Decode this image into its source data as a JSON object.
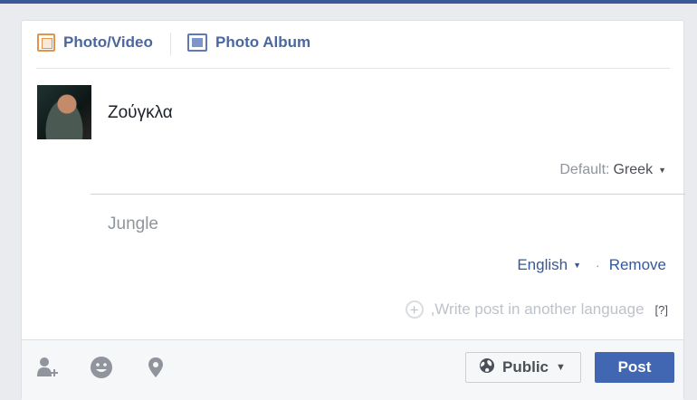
{
  "tabs": {
    "photo_video": "Photo/Video",
    "photo_album": "Photo Album"
  },
  "composer": {
    "post_text": "Ζούγκλα",
    "default_prefix": "Default:",
    "default_language": "Greek",
    "translation_text": "Jungle",
    "translation_language": "English",
    "separator": "·",
    "remove_label": "Remove",
    "write_another": ",Write post in another language",
    "help_badge": "[?]"
  },
  "footer": {
    "audience_label": "Public",
    "post_label": "Post"
  },
  "colors": {
    "brand": "#4267b2",
    "photo_icon": "#e2934d",
    "album_icon": "#5d79b9"
  }
}
